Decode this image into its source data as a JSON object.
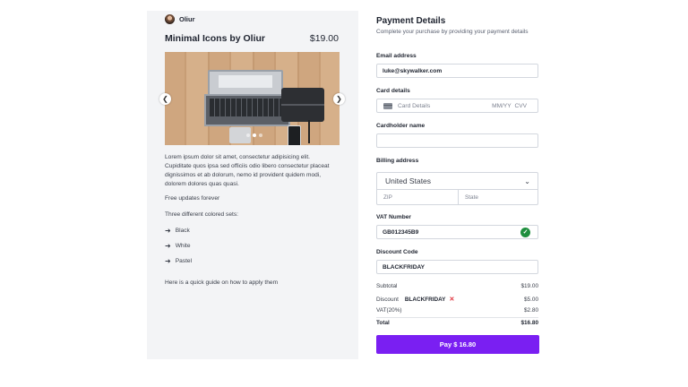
{
  "product": {
    "seller_name": "Oliur",
    "title": "Minimal Icons by Oliur",
    "price": "$19.00",
    "description": "Lorem ipsum dolor sit amet, consectetur adipisicing elit. Cupiditate quos ipsa sed officiis odio libero consectetur placeat dignissimos et ab dolorum, nemo id provident quidem modi, dolorem dolores quas quasi.",
    "free_updates": "Free updates forever",
    "sets_intro": "Three different colored sets:",
    "sets": [
      "Black",
      "White",
      "Pastel"
    ],
    "guide": "Here is a quick guide on how to apply them",
    "carousel": {
      "slide_count": 3,
      "active_slide": 2
    }
  },
  "payment": {
    "title": "Payment Details",
    "subtitle": "Complete your purchase by providing your payment details",
    "email": {
      "label": "Email address",
      "value": "luke@skywalker.com"
    },
    "card": {
      "label": "Card details",
      "placeholder": "Card Details",
      "expiry_placeholder": "MM/YY",
      "cvv_placeholder": "CVV"
    },
    "cardholder": {
      "label": "Cardholder name",
      "value": ""
    },
    "billing": {
      "label": "Billing address",
      "country": "United States",
      "zip_placeholder": "ZIP",
      "state_placeholder": "State"
    },
    "vat": {
      "label": "VAT Number",
      "value": "GB012345B9",
      "valid": true
    },
    "discount": {
      "label": "Discount Code",
      "value": "BLACKFRIDAY"
    },
    "summary": {
      "subtotal_label": "Subtotal",
      "subtotal": "$19.00",
      "discount_label": "Discount",
      "discount_code": "BLACKFRIDAY",
      "discount": "$5.00",
      "vat_label": "VAT(20%)",
      "vat": "$2.80",
      "total_label": "Total",
      "total": "$16.80"
    },
    "pay_button": "Pay $ 16.80"
  },
  "colors": {
    "accent": "#7a1ff2",
    "valid": "#1e8e3e",
    "remove": "#e0303a",
    "panel": "#f3f4f6"
  },
  "icons": [
    "avatar",
    "chevron-left-icon",
    "chevron-right-icon",
    "credit-card-icon",
    "chevron-down-icon",
    "check-circle-icon",
    "close-icon",
    "arrow-right-icon"
  ]
}
